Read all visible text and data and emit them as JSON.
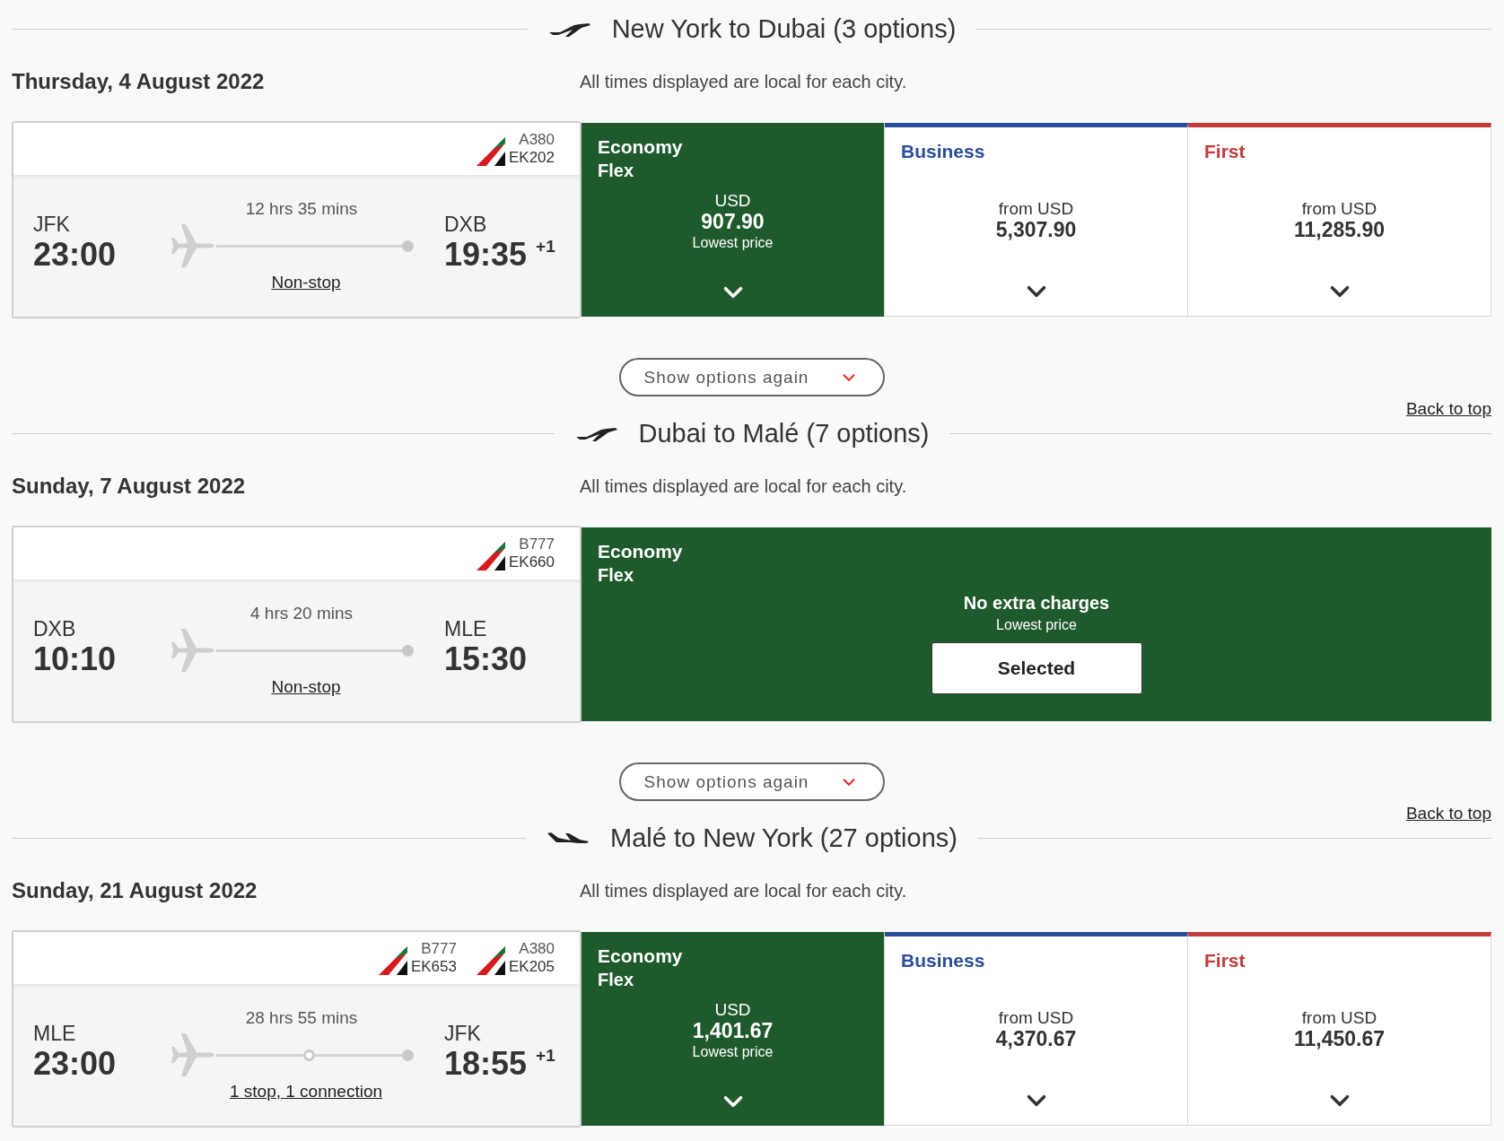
{
  "sections": [
    {
      "plane_icon": {
        "kind": "outbound"
      },
      "title": "New York to Dubai (3 options)",
      "date": "Thursday, 4 August 2022",
      "note": "All times displayed are local for each city.",
      "flight": {
        "kind": "nonstop",
        "segments": [
          {
            "aircraft": "A380",
            "number": "EK202"
          }
        ],
        "origin": "JFK",
        "depart": "23:00",
        "duration": "12 hrs 35 mins",
        "stops": "Non-stop",
        "destination": "DXB",
        "arrive": "19:35",
        "day_offset": "+1"
      },
      "kind": "options",
      "fares": [
        {
          "cabin": "Economy",
          "subtitle": "Flex",
          "price_label": "USD",
          "price": "907.90",
          "note": "Lowest price",
          "selected": true,
          "color": "#1f5a2c"
        },
        {
          "cabin": "Business",
          "price_label": "from USD",
          "price": "5,307.90",
          "selected": false,
          "color": "#2b4d9a"
        },
        {
          "cabin": "First",
          "price_label": "from USD",
          "price": "11,285.90",
          "selected": false,
          "color": "#c23a3a"
        }
      ],
      "show_options_button": "Show options again",
      "back_to_top": "Back to top"
    },
    {
      "plane_icon": {
        "kind": "outbound"
      },
      "title": "Dubai to Malé (7 options)",
      "date": "Sunday, 7 August 2022",
      "note": "All times displayed are local for each city.",
      "flight": {
        "kind": "nonstop",
        "segments": [
          {
            "aircraft": "B777",
            "number": "EK660"
          }
        ],
        "origin": "DXB",
        "depart": "10:10",
        "duration": "4 hrs 20 mins",
        "stops": "Non-stop",
        "destination": "MLE",
        "arrive": "15:30"
      },
      "kind": "chosen",
      "chosen": {
        "cabin": "Economy",
        "subtitle": "Flex",
        "headline": "No extra charges",
        "note": "Lowest price",
        "button": "Selected"
      },
      "show_options_button": "Show options again",
      "back_to_top": "Back to top"
    },
    {
      "plane_icon": {
        "kind": "return"
      },
      "title": "Malé to New York (27 options)",
      "date": "Sunday, 21 August 2022",
      "note": "All times displayed are local for each city.",
      "flight": {
        "kind": "connecting",
        "segments": [
          {
            "aircraft": "B777",
            "number": "EK653"
          },
          {
            "aircraft": "A380",
            "number": "EK205"
          }
        ],
        "origin": "MLE",
        "depart": "23:00",
        "duration": "28 hrs 55 mins",
        "stops": "1 stop, 1 connection",
        "destination": "JFK",
        "arrive": "18:55",
        "day_offset": "+1"
      },
      "kind": "options",
      "fares": [
        {
          "cabin": "Economy",
          "subtitle": "Flex",
          "price_label": "USD",
          "price": "1,401.67",
          "note": "Lowest price",
          "selected": true,
          "color": "#1f5a2c"
        },
        {
          "cabin": "Business",
          "price_label": "from USD",
          "price": "4,370.67",
          "selected": false,
          "color": "#2b4d9a"
        },
        {
          "cabin": "First",
          "price_label": "from USD",
          "price": "11,450.67",
          "selected": false,
          "color": "#c23a3a"
        }
      ]
    }
  ]
}
